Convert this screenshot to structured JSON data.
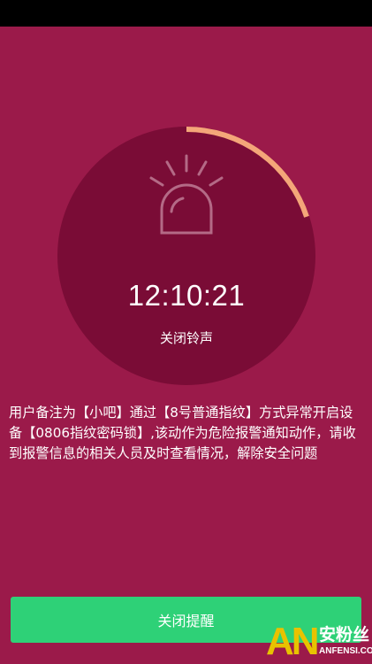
{
  "alarm": {
    "time": "12:10:21",
    "progress_fraction": 0.2,
    "close_ringtone_label": "关闭铃声"
  },
  "message": "用户备注为【小吧】通过【8号普通指纹】方式异常开启设备【0806指纹密码锁】,该动作为危险报警通知动作，请收到报警信息的相关人员及时查看情况，解除安全问题",
  "dismiss_button_label": "关闭提醒",
  "watermark": {
    "logo": "AN",
    "cn_text": "安粉丝",
    "en_text": "ANFENSI.COM"
  },
  "colors": {
    "background": "#9b1a4a",
    "circle": "#7a0c36",
    "progress": "#f4a679",
    "button": "#2ed177"
  },
  "icons": [
    "siren-icon"
  ]
}
